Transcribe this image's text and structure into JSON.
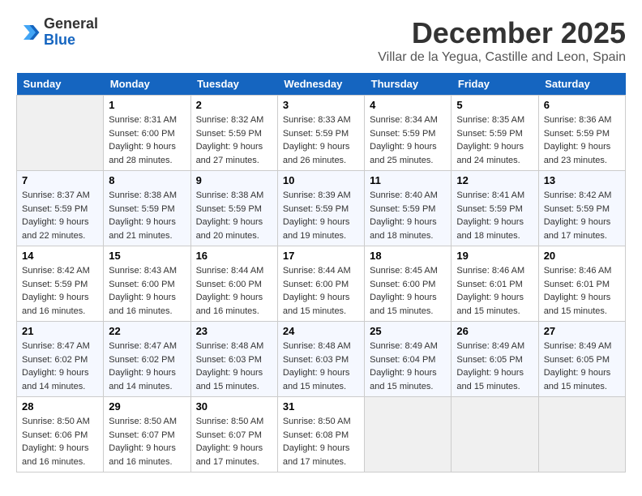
{
  "header": {
    "logo_general": "General",
    "logo_blue": "Blue",
    "month_title": "December 2025",
    "subtitle": "Villar de la Yegua, Castille and Leon, Spain"
  },
  "weekdays": [
    "Sunday",
    "Monday",
    "Tuesday",
    "Wednesday",
    "Thursday",
    "Friday",
    "Saturday"
  ],
  "weeks": [
    [
      {
        "day": "",
        "sunrise": "",
        "sunset": "",
        "daylight": "",
        "empty": true
      },
      {
        "day": "1",
        "sunrise": "8:31 AM",
        "sunset": "6:00 PM",
        "daylight": "9 hours and 28 minutes."
      },
      {
        "day": "2",
        "sunrise": "8:32 AM",
        "sunset": "5:59 PM",
        "daylight": "9 hours and 27 minutes."
      },
      {
        "day": "3",
        "sunrise": "8:33 AM",
        "sunset": "5:59 PM",
        "daylight": "9 hours and 26 minutes."
      },
      {
        "day": "4",
        "sunrise": "8:34 AM",
        "sunset": "5:59 PM",
        "daylight": "9 hours and 25 minutes."
      },
      {
        "day": "5",
        "sunrise": "8:35 AM",
        "sunset": "5:59 PM",
        "daylight": "9 hours and 24 minutes."
      },
      {
        "day": "6",
        "sunrise": "8:36 AM",
        "sunset": "5:59 PM",
        "daylight": "9 hours and 23 minutes."
      }
    ],
    [
      {
        "day": "7",
        "sunrise": "8:37 AM",
        "sunset": "5:59 PM",
        "daylight": "9 hours and 22 minutes."
      },
      {
        "day": "8",
        "sunrise": "8:38 AM",
        "sunset": "5:59 PM",
        "daylight": "9 hours and 21 minutes."
      },
      {
        "day": "9",
        "sunrise": "8:38 AM",
        "sunset": "5:59 PM",
        "daylight": "9 hours and 20 minutes."
      },
      {
        "day": "10",
        "sunrise": "8:39 AM",
        "sunset": "5:59 PM",
        "daylight": "9 hours and 19 minutes."
      },
      {
        "day": "11",
        "sunrise": "8:40 AM",
        "sunset": "5:59 PM",
        "daylight": "9 hours and 18 minutes."
      },
      {
        "day": "12",
        "sunrise": "8:41 AM",
        "sunset": "5:59 PM",
        "daylight": "9 hours and 18 minutes."
      },
      {
        "day": "13",
        "sunrise": "8:42 AM",
        "sunset": "5:59 PM",
        "daylight": "9 hours and 17 minutes."
      }
    ],
    [
      {
        "day": "14",
        "sunrise": "8:42 AM",
        "sunset": "5:59 PM",
        "daylight": "9 hours and 16 minutes."
      },
      {
        "day": "15",
        "sunrise": "8:43 AM",
        "sunset": "6:00 PM",
        "daylight": "9 hours and 16 minutes."
      },
      {
        "day": "16",
        "sunrise": "8:44 AM",
        "sunset": "6:00 PM",
        "daylight": "9 hours and 16 minutes."
      },
      {
        "day": "17",
        "sunrise": "8:44 AM",
        "sunset": "6:00 PM",
        "daylight": "9 hours and 15 minutes."
      },
      {
        "day": "18",
        "sunrise": "8:45 AM",
        "sunset": "6:00 PM",
        "daylight": "9 hours and 15 minutes."
      },
      {
        "day": "19",
        "sunrise": "8:46 AM",
        "sunset": "6:01 PM",
        "daylight": "9 hours and 15 minutes."
      },
      {
        "day": "20",
        "sunrise": "8:46 AM",
        "sunset": "6:01 PM",
        "daylight": "9 hours and 15 minutes."
      }
    ],
    [
      {
        "day": "21",
        "sunrise": "8:47 AM",
        "sunset": "6:02 PM",
        "daylight": "9 hours and 14 minutes."
      },
      {
        "day": "22",
        "sunrise": "8:47 AM",
        "sunset": "6:02 PM",
        "daylight": "9 hours and 14 minutes."
      },
      {
        "day": "23",
        "sunrise": "8:48 AM",
        "sunset": "6:03 PM",
        "daylight": "9 hours and 15 minutes."
      },
      {
        "day": "24",
        "sunrise": "8:48 AM",
        "sunset": "6:03 PM",
        "daylight": "9 hours and 15 minutes."
      },
      {
        "day": "25",
        "sunrise": "8:49 AM",
        "sunset": "6:04 PM",
        "daylight": "9 hours and 15 minutes."
      },
      {
        "day": "26",
        "sunrise": "8:49 AM",
        "sunset": "6:05 PM",
        "daylight": "9 hours and 15 minutes."
      },
      {
        "day": "27",
        "sunrise": "8:49 AM",
        "sunset": "6:05 PM",
        "daylight": "9 hours and 15 minutes."
      }
    ],
    [
      {
        "day": "28",
        "sunrise": "8:50 AM",
        "sunset": "6:06 PM",
        "daylight": "9 hours and 16 minutes."
      },
      {
        "day": "29",
        "sunrise": "8:50 AM",
        "sunset": "6:07 PM",
        "daylight": "9 hours and 16 minutes."
      },
      {
        "day": "30",
        "sunrise": "8:50 AM",
        "sunset": "6:07 PM",
        "daylight": "9 hours and 17 minutes."
      },
      {
        "day": "31",
        "sunrise": "8:50 AM",
        "sunset": "6:08 PM",
        "daylight": "9 hours and 17 minutes."
      },
      {
        "day": "",
        "sunrise": "",
        "sunset": "",
        "daylight": "",
        "empty": true
      },
      {
        "day": "",
        "sunrise": "",
        "sunset": "",
        "daylight": "",
        "empty": true
      },
      {
        "day": "",
        "sunrise": "",
        "sunset": "",
        "daylight": "",
        "empty": true
      }
    ]
  ]
}
